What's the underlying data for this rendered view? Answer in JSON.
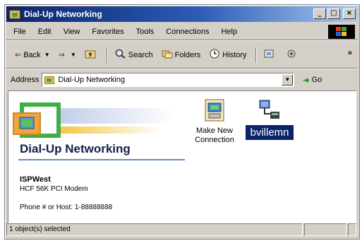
{
  "window": {
    "title": "Dial-Up Networking",
    "controls": {
      "minimize": "_",
      "maximize": "□",
      "close": "×"
    }
  },
  "menu": {
    "items": [
      {
        "label": "File",
        "accel": "F"
      },
      {
        "label": "Edit",
        "accel": "E"
      },
      {
        "label": "View",
        "accel": "V"
      },
      {
        "label": "Favorites",
        "accel": "a"
      },
      {
        "label": "Tools",
        "accel": "T"
      },
      {
        "label": "Connections",
        "accel": "C"
      },
      {
        "label": "Help",
        "accel": "H"
      }
    ]
  },
  "toolbar": {
    "back_label": "Back",
    "search_label": "Search",
    "folders_label": "Folders",
    "history_label": "History",
    "more_label": "»"
  },
  "address": {
    "label": "Address",
    "value": "Dial-Up Networking",
    "go_label": "Go"
  },
  "content": {
    "banner_title": "Dial-Up Networking",
    "selected": {
      "name": "ISPWest",
      "device": "HCF 56K PCI Modem",
      "phone": "Phone # or Host: 1-88888888"
    },
    "items": {
      "make_new_line1": "Make New",
      "make_new_line2": "Connection",
      "connection_name": "bvillemn"
    }
  },
  "status": {
    "text": "1 object(s) selected"
  },
  "colors": {
    "titlebar_start": "#0a246a",
    "selection": "#0a246a",
    "chrome": "#d4d0c8"
  },
  "icons": [
    "dialup-folder-icon",
    "back-arrow-icon",
    "forward-arrow-icon",
    "up-folder-icon",
    "search-icon",
    "folders-icon",
    "history-icon",
    "make-new-connection-icon",
    "network-connection-icon",
    "windows-logo-icon",
    "go-arrow-icon"
  ]
}
